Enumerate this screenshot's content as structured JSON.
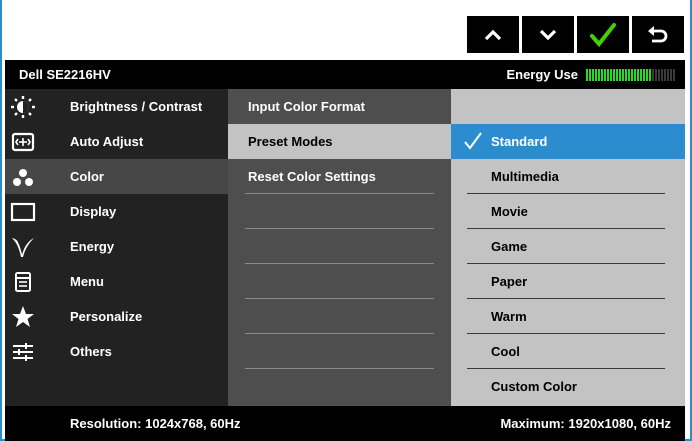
{
  "nav": {
    "buttons": [
      {
        "icon": "chevron-up-icon"
      },
      {
        "icon": "chevron-down-icon"
      },
      {
        "icon": "checkmark-icon",
        "color": "#46d000"
      },
      {
        "icon": "back-arrow-icon"
      }
    ]
  },
  "header": {
    "model": "Dell SE2216HV",
    "energy_label": "Energy Use",
    "energy_level": 0.72
  },
  "menu": {
    "items": [
      {
        "label": "Brightness / Contrast",
        "icon": "brightness-icon"
      },
      {
        "label": "Auto Adjust",
        "icon": "auto-adjust-icon"
      },
      {
        "label": "Color",
        "icon": "color-icon",
        "selected": true
      },
      {
        "label": "Display",
        "icon": "display-icon"
      },
      {
        "label": "Energy",
        "icon": "energy-icon"
      },
      {
        "label": "Menu",
        "icon": "menu-icon"
      },
      {
        "label": "Personalize",
        "icon": "star-icon"
      },
      {
        "label": "Others",
        "icon": "others-icon"
      }
    ]
  },
  "submenu": {
    "items": [
      {
        "label": "Input Color Format"
      },
      {
        "label": "Preset Modes",
        "selected": true
      },
      {
        "label": "Reset Color Settings"
      },
      {
        "label": ""
      },
      {
        "label": ""
      },
      {
        "label": ""
      },
      {
        "label": ""
      },
      {
        "label": ""
      },
      {
        "label": ""
      }
    ]
  },
  "options": {
    "items": [
      {
        "label": "Standard",
        "selected": true
      },
      {
        "label": "Multimedia"
      },
      {
        "label": "Movie"
      },
      {
        "label": "Game"
      },
      {
        "label": "Paper"
      },
      {
        "label": "Warm"
      },
      {
        "label": "Cool"
      },
      {
        "label": "Custom Color"
      }
    ]
  },
  "footer": {
    "resolution": "Resolution: 1024x768, 60Hz",
    "maximum": "Maximum: 1920x1080, 60Hz"
  },
  "colors": {
    "accent": "#2b8cd0",
    "check_green": "#46d000",
    "energy_green": "#22dd22"
  }
}
